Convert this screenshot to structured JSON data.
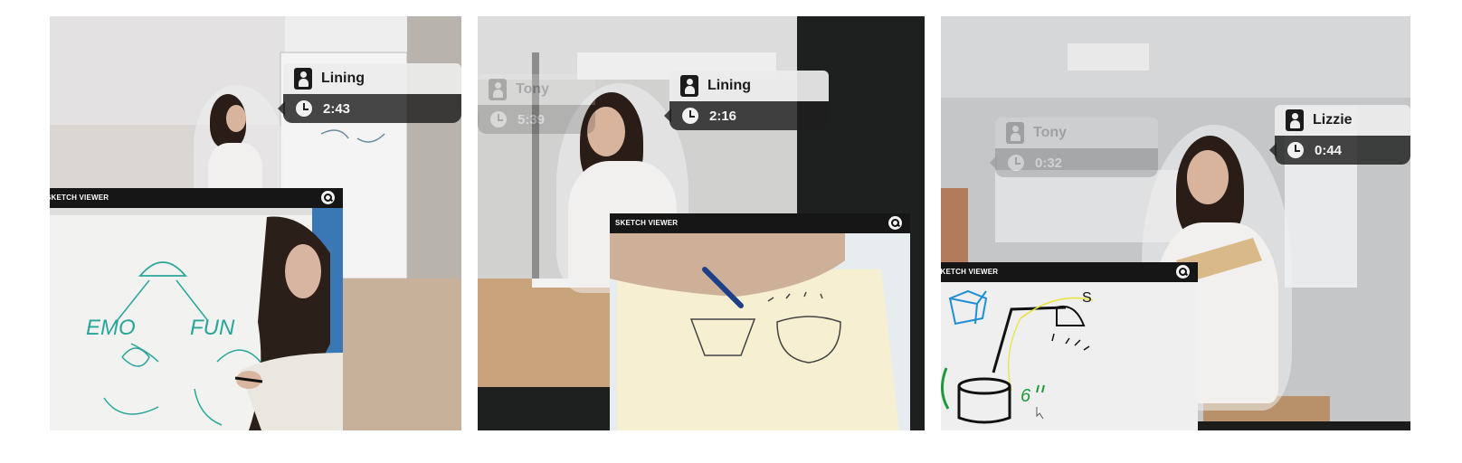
{
  "panels": [
    {
      "active_user": {
        "name": "Lining",
        "time": "2:43"
      },
      "viewer": {
        "title": "SKETCH VIEWER",
        "sketch_words": [
          "EMO",
          "FUN"
        ]
      }
    },
    {
      "ghost_user": {
        "name": "Tony",
        "time": "5:39"
      },
      "active_user": {
        "name": "Lining",
        "time": "2:16"
      },
      "viewer": {
        "title": "SKETCH VIEWER"
      }
    },
    {
      "ghost_user": {
        "name": "Tony",
        "time": "0:32"
      },
      "active_user": {
        "name": "Lizzie",
        "time": "0:44"
      },
      "viewer": {
        "title": "SKETCH VIEWER",
        "sketch_words": [
          "S"
        ]
      }
    }
  ],
  "colors": {
    "tag_light": "#ececec",
    "tag_dark": "#1e1e1e",
    "viewer_bar": "#161616",
    "marker_teal": "#2aa59a",
    "pen_blue": "#234a8e",
    "sketch_green": "#1f9a3a",
    "sketch_yellow": "#e8e23a",
    "sketch_cyan": "#1c8fd6"
  },
  "icons": [
    "person-icon",
    "clock-icon",
    "zoom-icon"
  ]
}
